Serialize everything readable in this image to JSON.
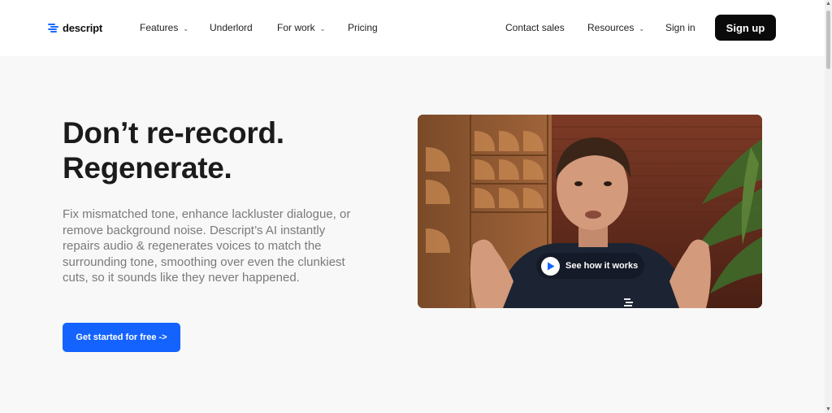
{
  "brand": {
    "name": "descript",
    "accent": "#1463ff"
  },
  "nav": {
    "features": "Features",
    "underlord": "Underlord",
    "for_work": "For work",
    "pricing": "Pricing",
    "contact_sales": "Contact sales",
    "resources": "Resources",
    "sign_in": "Sign in",
    "sign_up": "Sign up"
  },
  "hero": {
    "headline_line1": "Don’t re-record.",
    "headline_line2": "Regenerate.",
    "description": "Fix mismatched tone, enhance lackluster dialogue, or remove background noise. Descript’s AI instantly repairs audio & regenerates voices to match the surrounding tone, smoothing over even the clunkiest cuts, so it sounds like they never happened.",
    "cta_label": "Get started for free ->"
  },
  "video": {
    "play_label": "See how it works",
    "icon": "play-icon"
  }
}
